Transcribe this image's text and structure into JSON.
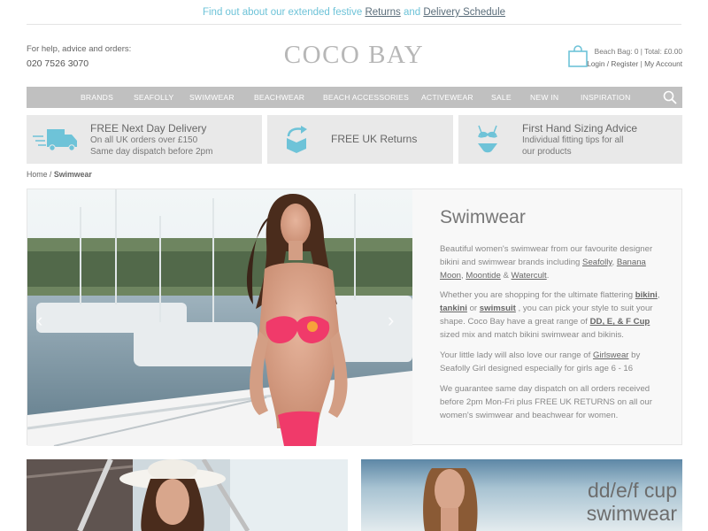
{
  "announcement": {
    "prefix": "Find out about our extended festive",
    "returns": "Returns",
    "and": "and",
    "delivery": "Delivery Schedule"
  },
  "header": {
    "help_text": "For help, advice and orders:",
    "phone": "020 7526 3070",
    "logo": "COCO BAY",
    "bag_summary": "Beach Bag: 0 | Total: £0.00",
    "login": "Login / Register",
    "sep": "|",
    "account": "My Account"
  },
  "nav": {
    "items": [
      "BRANDS",
      "SEAFOLLY",
      "SWIMWEAR",
      "BEACHWEAR",
      "BEACH ACCESSORIES",
      "ACTIVEWEAR",
      "SALE",
      "NEW IN",
      "INSPIRATION"
    ]
  },
  "usp": [
    {
      "icon": "delivery-truck-icon",
      "title": "FREE Next Day Delivery",
      "lines": [
        "On all UK orders over £150",
        "Same day dispatch before 2pm"
      ]
    },
    {
      "icon": "returns-box-icon",
      "title": "FREE UK Returns",
      "lines": []
    },
    {
      "icon": "bikini-icon",
      "title": "First Hand Sizing Advice",
      "lines": [
        "Individual fitting tips for all",
        "our products"
      ]
    }
  ],
  "breadcrumb": {
    "home": "Home",
    "sep": "/",
    "current": "Swimwear"
  },
  "hero": {
    "title": "Swimwear",
    "p1": {
      "a": "Beautiful women's swimwear from our favourite designer bikini and swimwear brands including ",
      "l1": "Seafolly",
      "b": ", ",
      "l2": "Banana Moon",
      "c": ",",
      "l3": "Moontide",
      "d": " & ",
      "l4": "Watercult",
      "e": "."
    },
    "p2": {
      "a": "Whether you are shopping for the ultimate flattering ",
      "l1": "bikini",
      "b": ",",
      "l2": "tankini",
      "c": " or ",
      "l3": "swimsuit",
      "d": " , you can pick your style to suit your shape. Coco Bay have a great range of ",
      "l4": "DD, E, & F Cup",
      "e": " sized mix and match bikini swimwear and bikinis."
    },
    "p3": {
      "a": "Your little lady will also love our range of ",
      "l1": "Girlswear",
      "b": " by Seafolly Girl designed especially for girls age 6 - 16"
    },
    "p4": "We guarantee same day dispatch on all orders received before 2pm Mon-Fri plus FREE UK RETURNS on all our women's swimwear and beachwear for women.",
    "prev": "‹",
    "next": "›"
  },
  "tiles": {
    "right_line1": "dd/e/f cup",
    "right_line2": "swimwear"
  },
  "colors": {
    "accent": "#6ec3d8",
    "nav_bg": "#c0c0c0",
    "usp_bg": "#e9e9e9",
    "bikini": "#f03a6a"
  }
}
